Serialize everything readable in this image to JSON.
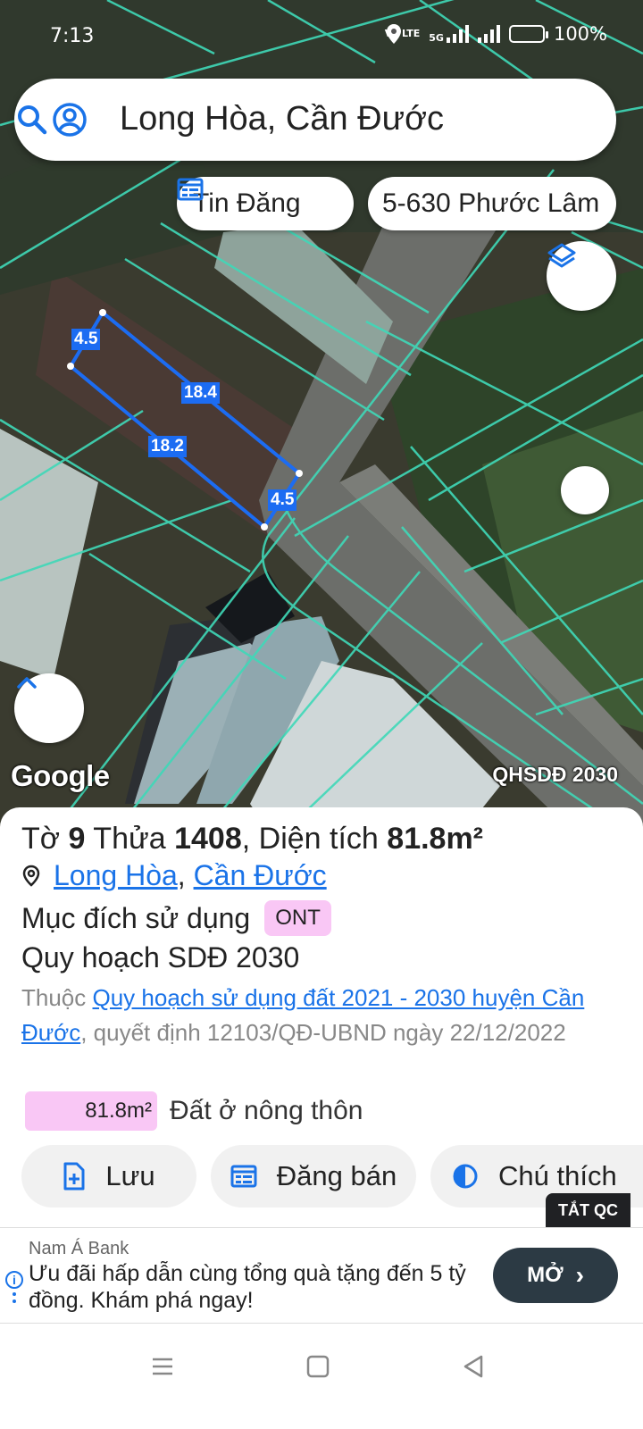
{
  "status_bar": {
    "time": "7:13",
    "network": "5G",
    "volte": "Vo LTE",
    "battery": "100%"
  },
  "search": {
    "query": "Long Hòa, Cần Đước",
    "account_icon": "account-circle-icon",
    "search_icon": "search-icon"
  },
  "chips": {
    "listing": "Tin Đăng",
    "address": "5-630 Phước Lâm"
  },
  "map": {
    "attribution": "Google",
    "overlay_label": "QHSDĐ 2030",
    "dimensions": {
      "top": "4.5",
      "long_top": "18.4",
      "long_bottom": "18.2",
      "right": "4.5"
    },
    "colors": {
      "parcel_lines": "#3fd9b8",
      "selection": "#1c6cf2"
    }
  },
  "parcel": {
    "sheet_label": "Tờ",
    "sheet_no": "9",
    "plot_label": "Thửa",
    "plot_no": "1408",
    "area_label": ", Diện tích",
    "area_value": "81.8m²",
    "location_link_1": "Long Hòa",
    "location_sep": ",",
    "location_link_2": "Cần Đước",
    "purpose_label": "Mục đích sử dụng",
    "purpose_code": "ONT",
    "plan_title": "Quy hoạch SDĐ 2030",
    "belong_prefix": "Thuộc",
    "belong_link": "Quy hoạch sử dụng đất 2021 - 2030 huyện Cần Đước",
    "belong_suffix": ", quyết định 12103/QĐ-UBND ngày 22/12/2022",
    "area_box": "81.8m²",
    "land_type": "Đất ở nông thôn"
  },
  "actions": {
    "save": "Lưu",
    "sell": "Đăng bán",
    "legend": "Chú thích",
    "hide_ads": "TẮT QC"
  },
  "ad": {
    "sponsor": "Nam Á Bank",
    "text": "Ưu đãi hấp dẫn cùng tổng quà tặng đến 5 tỷ đồng. Khám phá ngay!",
    "button": "MỞ"
  }
}
